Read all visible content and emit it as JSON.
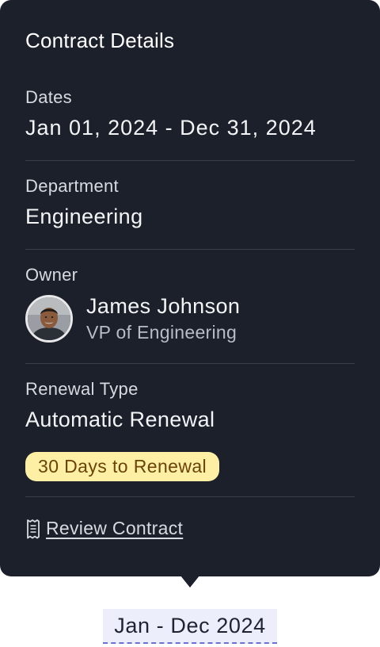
{
  "popover": {
    "title": "Contract Details",
    "dates": {
      "label": "Dates",
      "value": "Jan 01, 2024 - Dec 31, 2024"
    },
    "department": {
      "label": "Department",
      "value": "Engineering"
    },
    "owner": {
      "label": "Owner",
      "name": "James Johnson",
      "role": "VP of Engineering",
      "avatar_icon": "avatar-photo"
    },
    "renewal": {
      "label": "Renewal Type",
      "value": "Automatic Renewal",
      "badge": "30 Days to Renewal"
    },
    "review_link": {
      "icon": "receipt-icon",
      "label": "Review Contract"
    }
  },
  "trigger": {
    "label": "Jan - Dec 2024"
  },
  "colors": {
    "popover_bg": "#1c202b",
    "badge_bg": "#fdf0a5",
    "badge_text": "#6b4207",
    "trigger_bg": "#eceefb",
    "trigger_underline": "#6b6fd6"
  }
}
